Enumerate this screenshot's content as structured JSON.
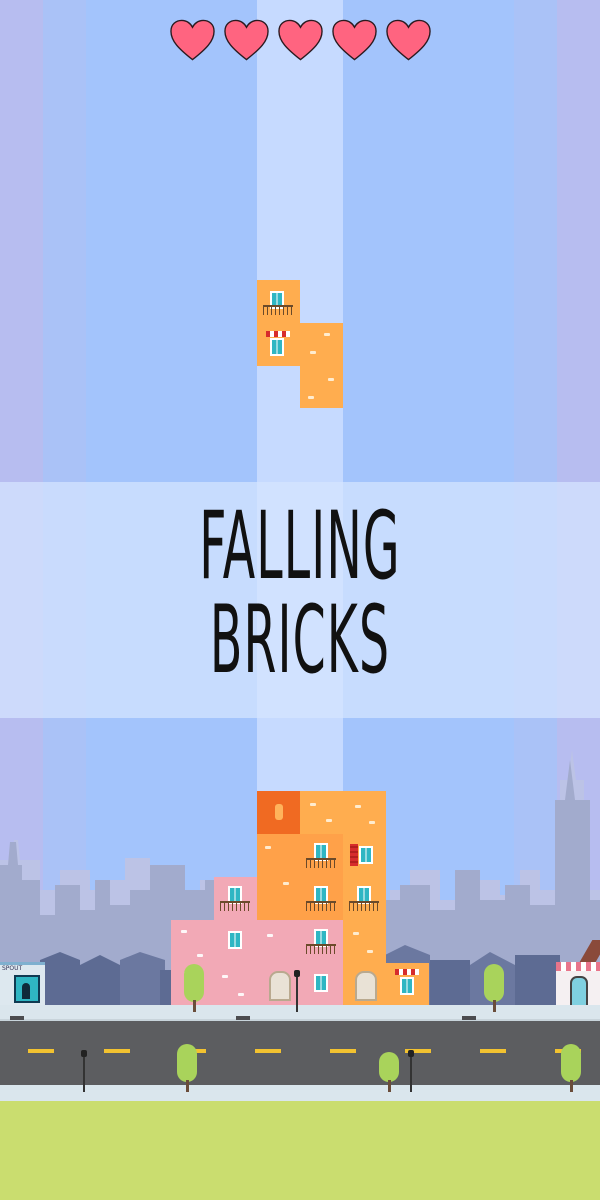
{
  "game": {
    "title_line1": "FALLING",
    "title_line2": "BRICKS",
    "lives": 5,
    "shop_sign": "SPOUT"
  },
  "colors": {
    "heart": "#ff6480",
    "brick_orange": "#ffad4f",
    "brick_pink": "#f2a9b6",
    "brick_dark": "#f06a22",
    "road": "#5c5d60",
    "lane_marking": "#f2c230",
    "grass": "#cadd6f"
  },
  "icons": [
    "heart-icon",
    "window-icon",
    "balcony-icon",
    "tree-icon",
    "street-lamp-icon"
  ]
}
